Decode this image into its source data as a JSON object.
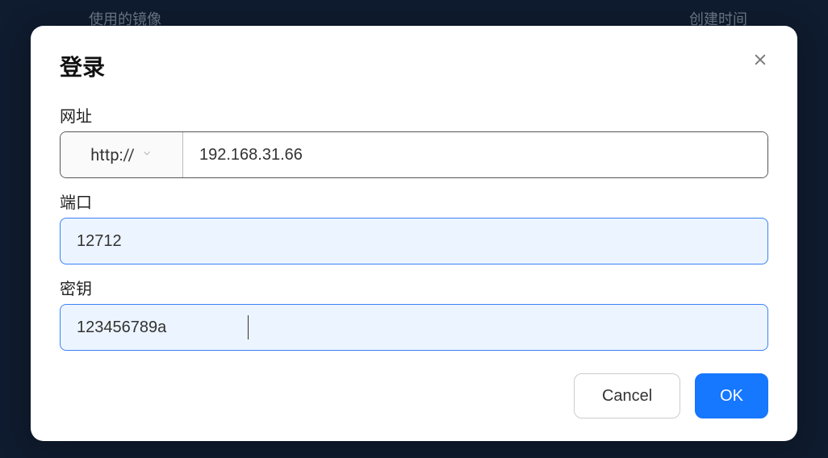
{
  "background": {
    "left_header": "使用的镜像",
    "right_header": "创建时间"
  },
  "modal": {
    "title": "登录",
    "fields": {
      "url": {
        "label": "网址",
        "protocol": "http://",
        "value": "192.168.31.66"
      },
      "port": {
        "label": "端口",
        "value": "12712"
      },
      "secret": {
        "label": "密钥",
        "value": "123456789a"
      }
    },
    "buttons": {
      "cancel": "Cancel",
      "ok": "OK"
    }
  }
}
